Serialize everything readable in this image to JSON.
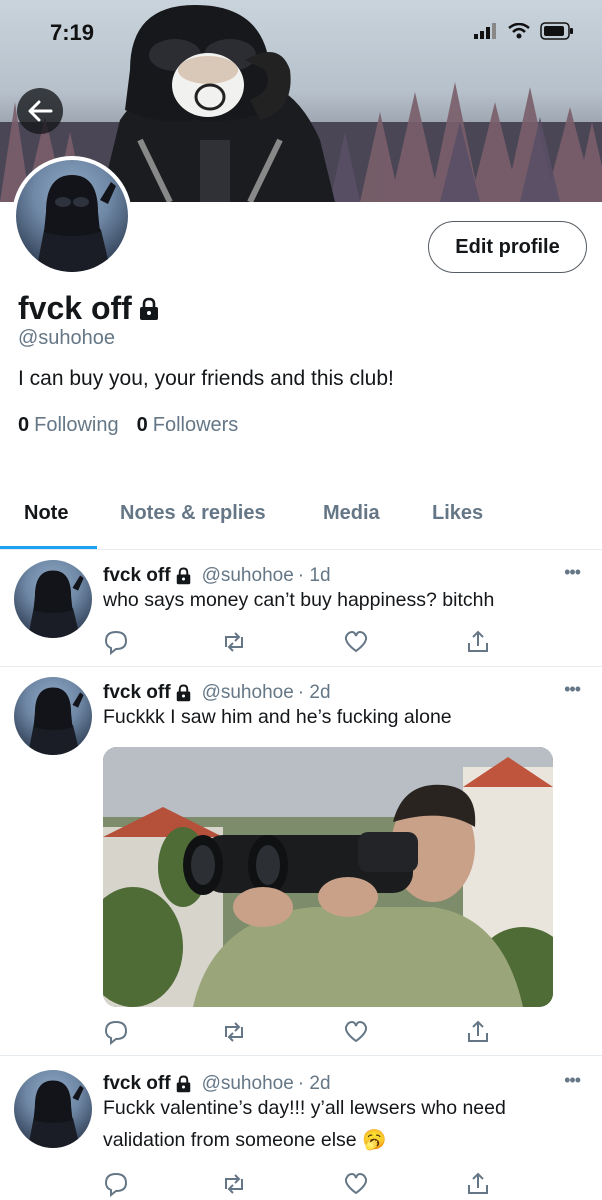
{
  "status_bar": {
    "time": "7:19"
  },
  "profile": {
    "name": "fvck off",
    "handle": "@suhohoe",
    "bio": "I can buy you, your friends and this club!",
    "edit_button": "Edit profile",
    "following_count": "0",
    "following_label": "Following",
    "followers_count": "0",
    "followers_label": "Followers"
  },
  "tabs": [
    {
      "label": "Note",
      "active": true
    },
    {
      "label": "Notes & replies",
      "active": false
    },
    {
      "label": "Media",
      "active": false
    },
    {
      "label": "Likes",
      "active": false
    }
  ],
  "notes": [
    {
      "name": "fvck off",
      "handle": "@suhohoe",
      "time": "· 1d",
      "text": "who says money can’t buy happiness? bitchh"
    },
    {
      "name": "fvck off",
      "handle": "@suhohoe",
      "time": "· 2d",
      "text": "Fuckkk I saw him and he’s fucking alone",
      "has_media": true
    },
    {
      "name": "fvck off",
      "handle": "@suhohoe",
      "time": "· 2d",
      "text": "Fuckk valentine’s day!!! y’all lewsers who need validation from someone else 🥱"
    }
  ],
  "colors": {
    "accent": "#1da1f2",
    "muted": "#657786",
    "text": "#14171a"
  },
  "icons": [
    "back-arrow-icon",
    "lock-icon",
    "reply-icon",
    "retweet-icon",
    "like-icon",
    "share-icon",
    "more-icon",
    "signal-icon",
    "wifi-icon",
    "battery-icon"
  ]
}
